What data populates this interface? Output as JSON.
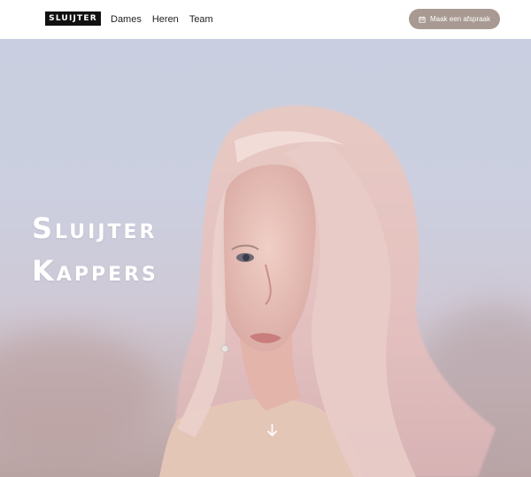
{
  "header": {
    "logo_text": "SLUIJTER",
    "nav": [
      {
        "label": "Dames"
      },
      {
        "label": "Heren"
      },
      {
        "label": "Team"
      }
    ],
    "cta_label": "Maak een afspraak",
    "cta_icon": "calendar-icon"
  },
  "hero": {
    "title_line1": "Sluijter",
    "title_line2": "Kappers",
    "scroll_icon": "arrow-down-icon"
  },
  "colors": {
    "cta_bg": "#a89a92",
    "logo_bg": "#111111",
    "sky": "#c9cfe0"
  }
}
